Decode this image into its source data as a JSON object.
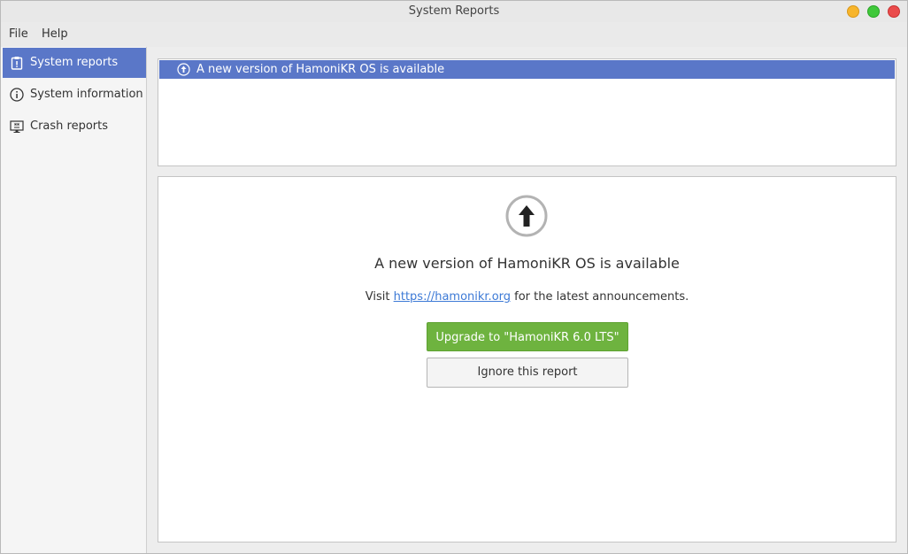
{
  "window": {
    "title": "System Reports"
  },
  "menubar": {
    "file": "File",
    "help": "Help"
  },
  "sidebar": {
    "items": [
      {
        "label": "System reports",
        "icon": "clipboard-alert-icon",
        "selected": true
      },
      {
        "label": "System information",
        "icon": "info-icon",
        "selected": false
      },
      {
        "label": "Crash reports",
        "icon": "monitor-crash-icon",
        "selected": false
      }
    ]
  },
  "reports": {
    "items": [
      {
        "label": "A new version of HamoniKR OS is available",
        "icon": "upgrade-arrow-icon",
        "selected": true
      }
    ]
  },
  "detail": {
    "icon": "upgrade-arrow-icon",
    "title": "A new version of HamoniKR OS is available",
    "text_before": "Visit ",
    "link": "https://hamonikr.org",
    "text_after": " for the latest announcements.",
    "upgrade_button": "Upgrade to \"HamoniKR 6.0 LTS\"",
    "ignore_button": "Ignore this report"
  },
  "colors": {
    "selection": "#5a77c8",
    "upgrade_button": "#6eb33f",
    "link": "#3d7ad6",
    "close": "#ea4b4b",
    "minimize": "#f7b52b",
    "maximize": "#3fc83a"
  }
}
